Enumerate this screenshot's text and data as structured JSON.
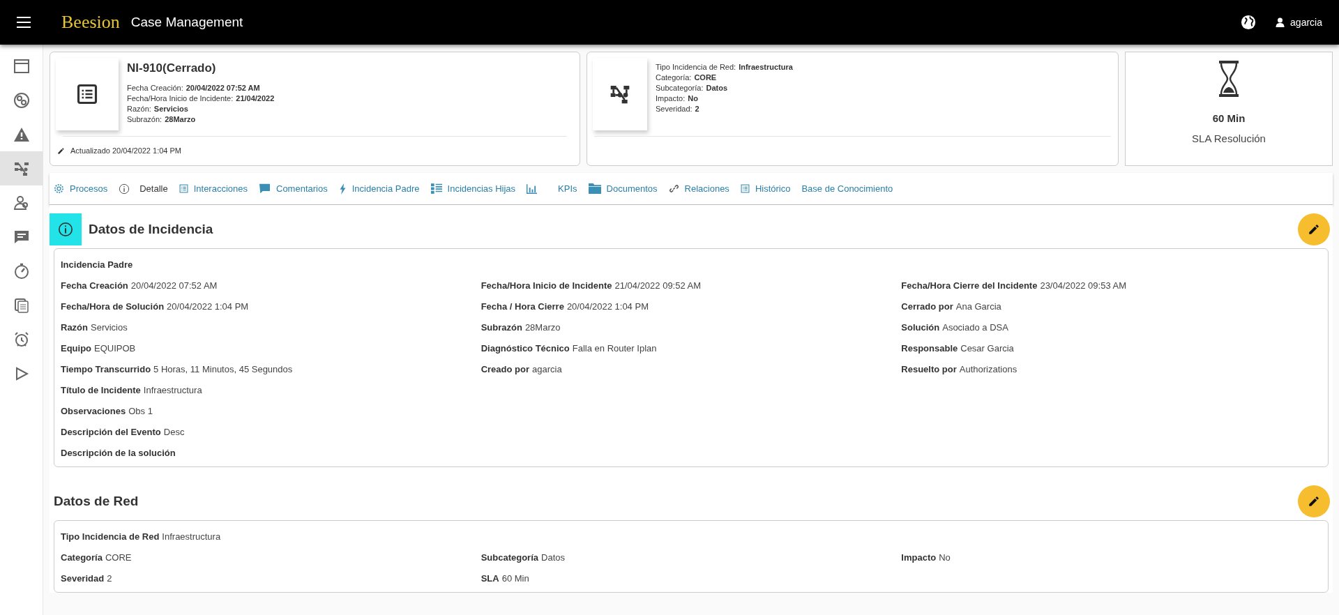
{
  "header": {
    "logo": "Beesion",
    "title": "Case Management",
    "user": "agarcia"
  },
  "sidebar": {
    "items": [
      {
        "kind": "window",
        "selected": false
      },
      {
        "kind": "globe",
        "selected": false
      },
      {
        "kind": "warning",
        "selected": false
      },
      {
        "kind": "network",
        "selected": true
      },
      {
        "kind": "users",
        "selected": false
      },
      {
        "kind": "chat",
        "selected": false
      },
      {
        "kind": "timer",
        "selected": false
      },
      {
        "kind": "copy",
        "selected": false
      },
      {
        "kind": "alarm",
        "selected": false
      },
      {
        "kind": "play",
        "selected": false
      }
    ]
  },
  "case_card": {
    "title": "NI-910(Cerrado)",
    "fields": [
      {
        "label": "Fecha Creación:",
        "value": "20/04/2022 07:52 AM"
      },
      {
        "label": "Fecha/Hora Inicio de Incidente:",
        "value": "21/04/2022"
      },
      {
        "label": "Razón:",
        "value": "Servicios"
      },
      {
        "label": "Subrazón:",
        "value": "28Marzo"
      }
    ],
    "updated": "Actualizado 20/04/2022 1:04 PM"
  },
  "network_card": {
    "fields": [
      {
        "label": "Tipo Incidencia de Red:",
        "value": "Infraestructura"
      },
      {
        "label": "Categoría:",
        "value": "CORE"
      },
      {
        "label": "Subcategoría:",
        "value": "Datos"
      },
      {
        "label": "Impacto:",
        "value": "No"
      },
      {
        "label": "Severidad:",
        "value": "2"
      }
    ]
  },
  "sla_card": {
    "value": "60 Min",
    "label": "SLA Resolución"
  },
  "tabs": [
    {
      "label": "Procesos",
      "kind": "gear",
      "selected": false
    },
    {
      "label": "Detalle",
      "kind": "info",
      "selected": true
    },
    {
      "label": "Interacciones",
      "kind": "list",
      "selected": false
    },
    {
      "label": "Comentarios",
      "kind": "comment",
      "selected": false
    },
    {
      "label": "Incidencia Padre",
      "kind": "bolt",
      "selected": false
    },
    {
      "label": "Incidencias Hijas",
      "kind": "tree",
      "selected": false
    },
    {
      "label": "KPIs",
      "kind": "chart",
      "selected": false
    },
    {
      "label": "Documentos",
      "kind": "folder",
      "selected": false
    },
    {
      "label": "Relaciones",
      "kind": "link",
      "selected": false
    },
    {
      "label": "Histórico",
      "kind": "list",
      "selected": false
    },
    {
      "label": "Base de Conocimiento",
      "kind": "plain",
      "selected": false
    }
  ],
  "sections": [
    {
      "title": "Datos de Incidencia",
      "kind": "info",
      "rows": [
        [
          {
            "label": "Incidencia Padre"
          }
        ],
        [
          {
            "label": "Fecha Creación",
            "value": "20/04/2022 07:52 AM"
          },
          {
            "label": "Fecha/Hora Inicio de Incidente",
            "value": "21/04/2022 09:52 AM"
          },
          {
            "label": "Fecha/Hora Cierre del Incidente",
            "value": "23/04/2022 09:53 AM"
          }
        ],
        [
          {
            "label": "Fecha/Hora de Solución",
            "value": "20/04/2022 1:04 PM"
          },
          {
            "label": "Fecha / Hora Cierre",
            "value": "20/04/2022 1:04 PM"
          },
          {
            "label": "Cerrado por",
            "value": "Ana Garcia"
          }
        ],
        [
          {
            "label": "Razón",
            "value": "Servicios"
          },
          {
            "label": "Subrazón",
            "value": "28Marzo"
          },
          {
            "label": "Solución",
            "value": "Asociado a DSA"
          }
        ],
        [
          {
            "label": "Equipo",
            "value": "EQUIPOB"
          },
          {
            "label": "Diagnóstico Técnico",
            "value": "Falla en Router Iplan"
          },
          {
            "label": "Responsable",
            "value": "Cesar Garcia"
          }
        ],
        [
          {
            "label": "Tiempo Transcurrido",
            "value": "5 Horas, 11 Minutos, 45 Segundos"
          },
          {
            "label": "Creado por",
            "value": "agarcia"
          },
          {
            "label": "Resuelto por",
            "value": "Authorizations"
          }
        ],
        [
          {
            "label": "Título de Incidente",
            "value": "Infraestructura"
          }
        ],
        [
          {
            "label": "Observaciones",
            "value": "Obs 1"
          }
        ],
        [
          {
            "label": "Descripción del Evento",
            "value": "Desc"
          }
        ],
        [
          {
            "label": "Descripción de la solución"
          }
        ]
      ]
    },
    {
      "title": "Datos de Red",
      "kind": "plain",
      "rows": [
        [
          {
            "label": "Tipo Incidencia de Red",
            "value": "Infraestructura"
          }
        ],
        [
          {
            "label": "Categoría",
            "value": "CORE"
          },
          {
            "label": "Subcategoría",
            "value": "Datos"
          },
          {
            "label": "Impacto",
            "value": "No"
          }
        ],
        [
          {
            "label": "Severidad",
            "value": "2"
          },
          {
            "label": "SLA",
            "value": "60 Min"
          }
        ]
      ]
    }
  ]
}
